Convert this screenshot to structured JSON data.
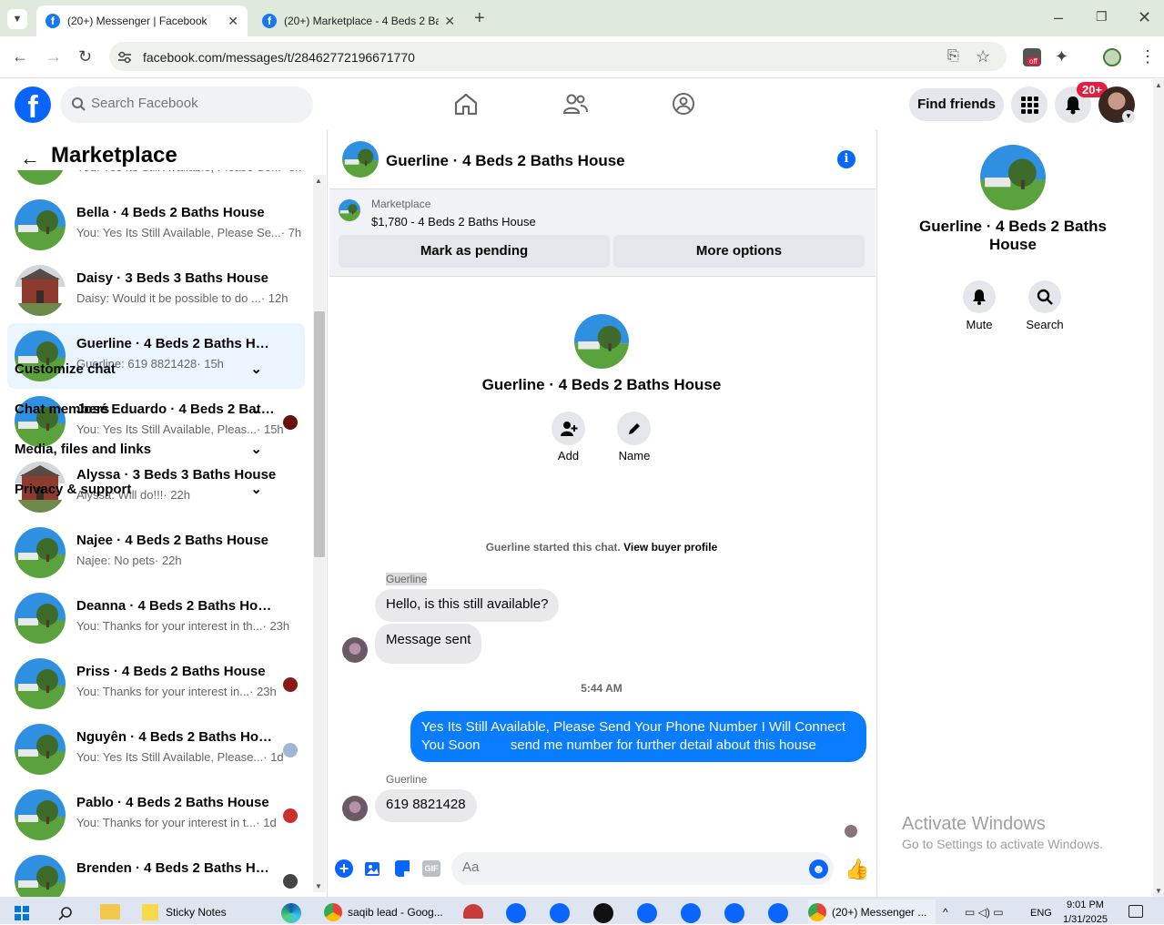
{
  "browser": {
    "tabs": [
      {
        "title": "(20+) Messenger | Facebook"
      },
      {
        "title": "(20+) Marketplace - 4 Beds 2 Ba"
      }
    ],
    "url": "facebook.com/messages/t/28462772196671770",
    "extension_badge": "off"
  },
  "header": {
    "search_placeholder": "Search Facebook",
    "find_friends": "Find friends",
    "notif_badge": "20+"
  },
  "left": {
    "title": "Marketplace",
    "conversations": [
      {
        "name": "",
        "preview": "You: Yes Its Still Available, Please Se...",
        "time": "· 6h"
      },
      {
        "name": "Bella · 4 Beds 2 Baths House",
        "preview": "You: Yes Its Still Available, Please Se...",
        "time": "· 7h"
      },
      {
        "name": "Daisy · 3 Beds 3 Baths House",
        "preview": "Daisy: Would it be possible to do ...",
        "time": "· 12h"
      },
      {
        "name": "Guerline · 4 Beds 2 Baths House",
        "preview": "Guerline: 619 8821428",
        "time": "· 15h"
      },
      {
        "name": "José Eduardo · 4 Beds 2 Baths...",
        "preview": "You: Yes Its Still Available, Pleas...",
        "time": "· 15h"
      },
      {
        "name": "Alyssa · 3 Beds 3 Baths House",
        "preview": "Alyssa: Will do!!!",
        "time": "· 22h"
      },
      {
        "name": "Najee · 4 Beds 2 Baths House",
        "preview": "Najee: No pets",
        "time": "· 22h"
      },
      {
        "name": "Deanna · 4 Beds 2 Baths House",
        "preview": "You: Thanks for your interest in th...",
        "time": "· 23h"
      },
      {
        "name": "Priss · 4 Beds 2 Baths House",
        "preview": "You: Thanks for your interest in...",
        "time": "· 23h"
      },
      {
        "name": "Nguyên · 4 Beds 2 Baths House",
        "preview": "You: Yes Its Still Available, Please...",
        "time": "· 1d"
      },
      {
        "name": "Pablo · 4 Beds 2 Baths House",
        "preview": "You: Thanks for your interest in t...",
        "time": "· 1d"
      },
      {
        "name": "Brenden · 4 Beds 2 Baths Hou...",
        "preview": "",
        "time": ""
      }
    ]
  },
  "chat": {
    "title": "Guerline · 4 Beds 2 Baths House",
    "marketplace_label": "Marketplace",
    "listing": "$1,780 - 4 Beds 2 Baths House",
    "mark_pending": "Mark as pending",
    "more_options": "More options",
    "profile_name": "Guerline · 4 Beds 2 Baths House",
    "add_label": "Add",
    "name_label": "Name",
    "started_text": "Guerline started this chat.",
    "view_buyer": "View buyer profile",
    "sender1": "Guerline",
    "msg1": "Hello, is this still available?",
    "msg2": "Message sent",
    "time_sep": "5:44 AM",
    "my_msg": "Yes Its Still Available, Please Send Your Phone Number I Will Connect You Soon        send me number for further detail about this house",
    "sender2": "Guerline",
    "msg3": "619 8821428",
    "composer_placeholder": "Aa"
  },
  "right": {
    "name": "Guerline · 4 Beds 2 Baths House",
    "mute": "Mute",
    "search": "Search",
    "sections": [
      "Customize chat",
      "Chat members",
      "Media, files and links",
      "Privacy & support"
    ],
    "watermark_title": "Activate Windows",
    "watermark_sub": "Go to Settings to activate Windows."
  },
  "taskbar": {
    "sticky_notes": "Sticky Notes",
    "chrome1": "saqib lead - Goog...",
    "chrome2": "(20+) Messenger ...",
    "lang": "ENG",
    "time": "9:01 PM",
    "date": "1/31/2025"
  }
}
